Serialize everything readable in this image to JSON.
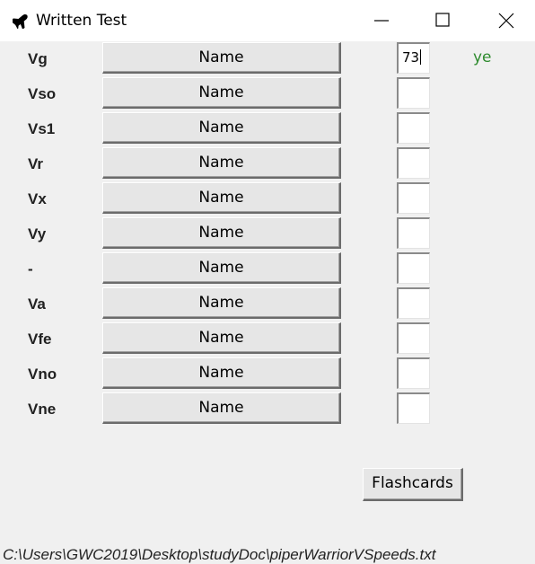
{
  "window": {
    "title": "Written Test",
    "icon": "airplane-icon",
    "controls": [
      "minimize-icon",
      "maximize-icon",
      "close-icon"
    ]
  },
  "rows": [
    {
      "code": "Vg",
      "button_label": "Name",
      "answer": "73",
      "feedback": "ye"
    },
    {
      "code": "Vso",
      "button_label": "Name",
      "answer": "",
      "feedback": ""
    },
    {
      "code": "Vs1",
      "button_label": "Name",
      "answer": "",
      "feedback": ""
    },
    {
      "code": "Vr",
      "button_label": "Name",
      "answer": "",
      "feedback": ""
    },
    {
      "code": "Vx",
      "button_label": "Name",
      "answer": "",
      "feedback": ""
    },
    {
      "code": "Vy",
      "button_label": "Name",
      "answer": "",
      "feedback": ""
    },
    {
      "code": "-",
      "button_label": "Name",
      "answer": "",
      "feedback": ""
    },
    {
      "code": "Va",
      "button_label": "Name",
      "answer": "",
      "feedback": ""
    },
    {
      "code": "Vfe",
      "button_label": "Name",
      "answer": "",
      "feedback": ""
    },
    {
      "code": "Vno",
      "button_label": "Name",
      "answer": "",
      "feedback": ""
    },
    {
      "code": "Vne",
      "button_label": "Name",
      "answer": "",
      "feedback": ""
    }
  ],
  "flashcards_label": "Flashcards",
  "file_path": "C:\\Users\\GWC2019\\Desktop\\studyDoc\\piperWarriorVSpeeds.txt",
  "colors": {
    "feedback_correct": "#2e8b2e",
    "background": "#f0f0f0"
  }
}
